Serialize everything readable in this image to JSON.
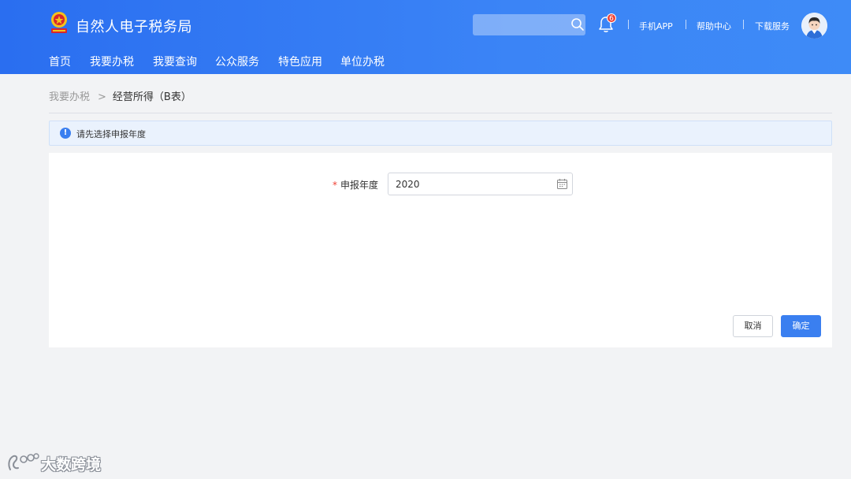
{
  "header": {
    "site_title": "自然人电子税务局",
    "search": {
      "value": "",
      "placeholder": ""
    },
    "notification_count": "6",
    "links": {
      "mobile_app": "手机APP",
      "help_center": "帮助中心",
      "download": "下载服务"
    }
  },
  "nav": {
    "items": [
      {
        "label": "首页"
      },
      {
        "label": "我要办税"
      },
      {
        "label": "我要查询"
      },
      {
        "label": "公众服务"
      },
      {
        "label": "特色应用"
      },
      {
        "label": "单位办税"
      }
    ]
  },
  "breadcrumb": {
    "parent": "我要办税",
    "separator": ">",
    "current": "经营所得（B表）"
  },
  "alert": {
    "text": "请先选择申报年度"
  },
  "form": {
    "required_mark": "*",
    "year_label": "申报年度",
    "year_value": "2020"
  },
  "actions": {
    "cancel": "取消",
    "confirm": "确定"
  },
  "watermark": {
    "text": "大数跨境"
  },
  "colors": {
    "header_blue": "#2a6ef0",
    "primary": "#3a7ff0",
    "badge_red": "#f04134",
    "page_bg": "#f2f3f5"
  }
}
